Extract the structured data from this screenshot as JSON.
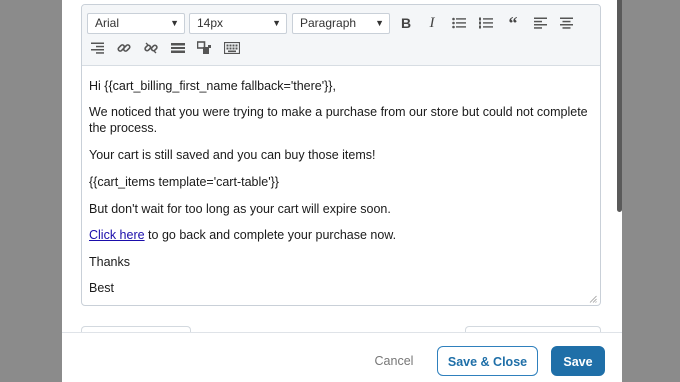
{
  "toolbar": {
    "font_family": "Arial",
    "font_size": "14px",
    "block_format": "Paragraph",
    "buttons": [
      "bold",
      "italic",
      "bullet-list",
      "numbered-list",
      "blockquote",
      "align-left",
      "align-center",
      "align-right",
      "link",
      "unlink",
      "horizontal-rule",
      "special-character",
      "keyboard"
    ]
  },
  "content": {
    "line1": "Hi {{cart_billing_first_name fallback='there'}},",
    "line2": "We noticed that you were trying to make a purchase from our store but could not complete the process.",
    "line3": "Your cart is still saved and you can buy those items!",
    "line4": "{{cart_items template='cart-table'}}",
    "line5": "But don't wait for too long as your cart will expire soon.",
    "link_text": "Click here",
    "line6_rest": " to go back and complete your purchase now.",
    "line7": "Thanks",
    "line8": "Best"
  },
  "footer": {
    "cancel": "Cancel",
    "save_close": "Save & Close",
    "save": "Save"
  },
  "colors": {
    "primary": "#1f6fa8",
    "overlay": "#8b8b8b"
  }
}
